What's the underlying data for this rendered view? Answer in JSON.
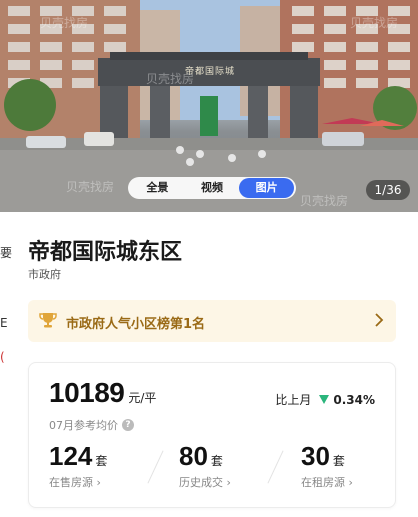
{
  "hero": {
    "gate_sign": "帝都国际城",
    "watermark": "贝壳找房",
    "media_tabs": [
      {
        "label": "全景",
        "active": false
      },
      {
        "label": "视频",
        "active": false
      },
      {
        "label": "图片",
        "active": true
      }
    ],
    "page_counter": "1/36"
  },
  "community": {
    "title": "帝都国际城东区",
    "district": "市政府"
  },
  "rank_banner": {
    "text": "市政府人气小区榜第1名",
    "icon": "trophy-icon"
  },
  "price_card": {
    "price": "10189",
    "price_unit": "元/平",
    "price_label": "07月参考均价",
    "mom_label": "比上月",
    "mom_value": "0.34%",
    "mom_direction": "down",
    "mom_color": "#2bb57c",
    "stats": [
      {
        "value": "124",
        "unit": "套",
        "label": "在售房源 ›"
      },
      {
        "value": "80",
        "unit": "套",
        "label": "历史成交 ›"
      },
      {
        "value": "30",
        "unit": "套",
        "label": "在租房源 ›"
      }
    ]
  },
  "edge_fragments": [
    "要",
    "E",
    "("
  ],
  "colors": {
    "accent": "#3a6bf0",
    "rank_bg": "#fdf6e6",
    "rank_text": "#9a6a16"
  }
}
